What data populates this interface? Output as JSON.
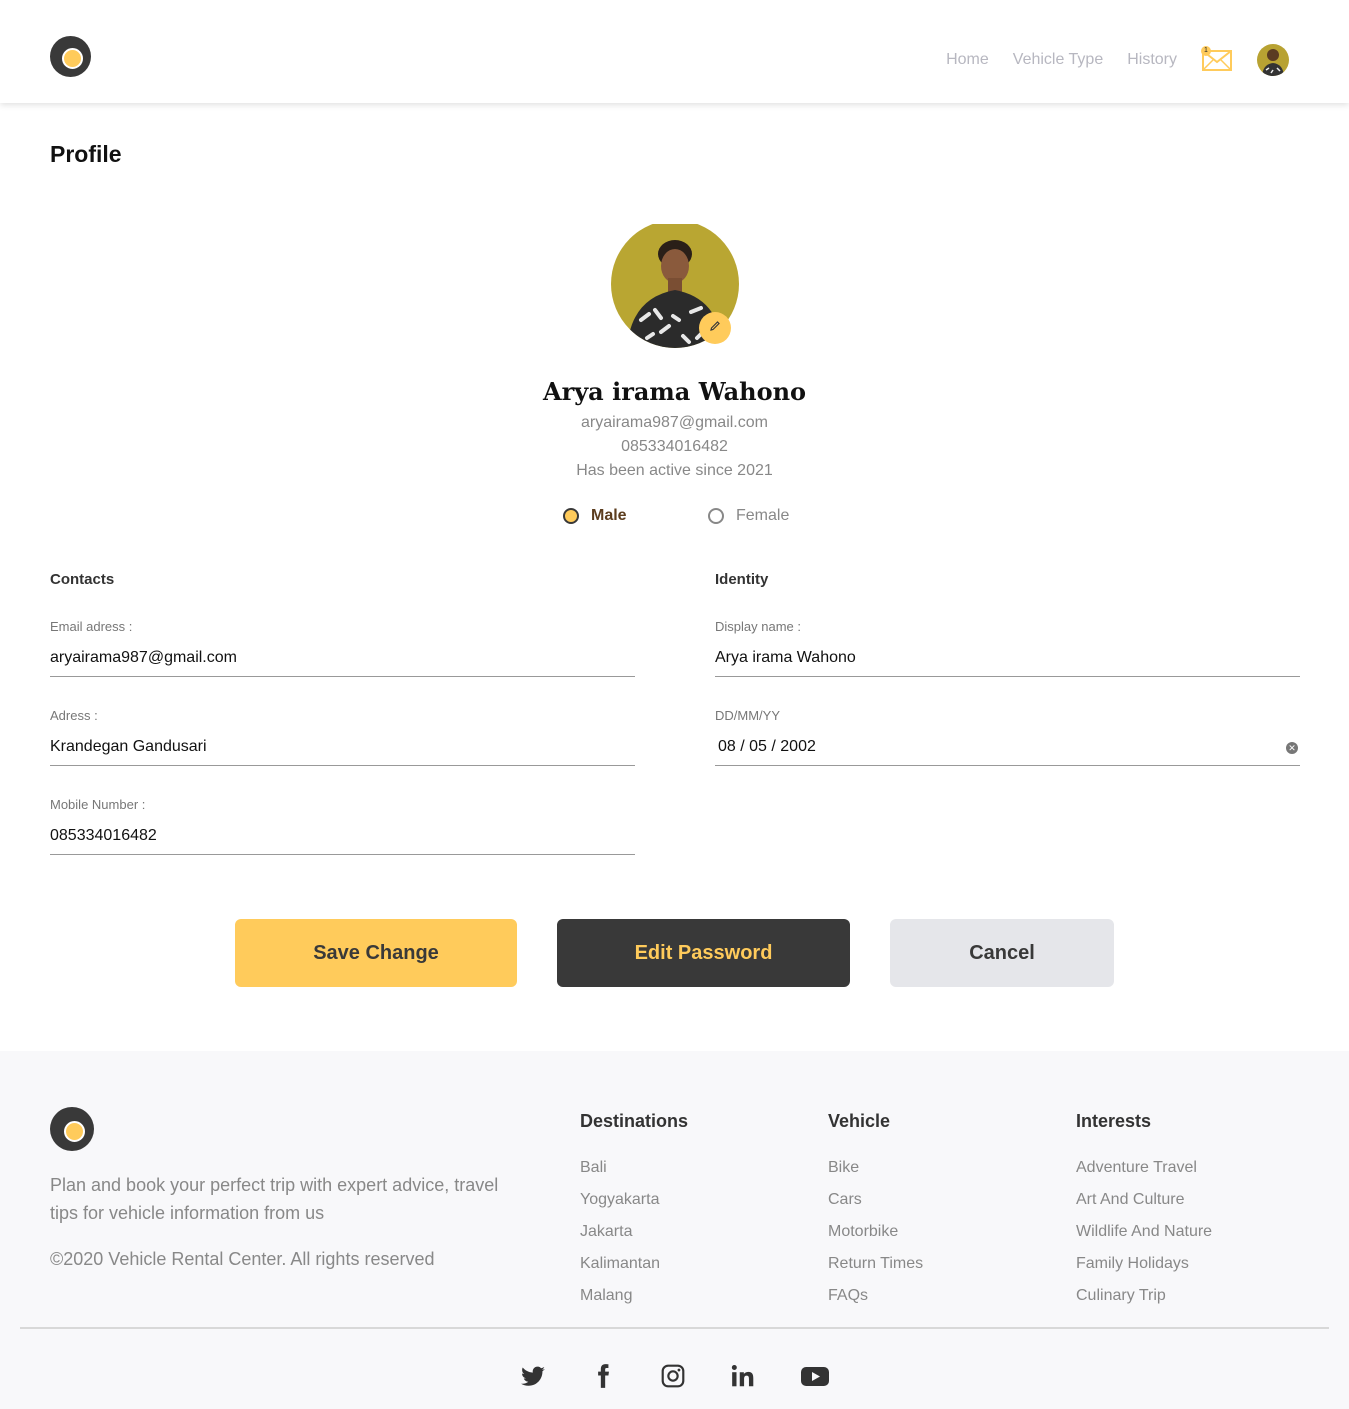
{
  "header": {
    "nav": [
      "Home",
      "Vehicle Type",
      "History"
    ],
    "mail_badge": "1"
  },
  "page_title": "Profile",
  "profile": {
    "name": "Arya irama Wahono",
    "email": "aryairama987@gmail.com",
    "phone": "085334016482",
    "active_since": "Has been active since 2021",
    "gender": {
      "male": "Male",
      "female": "Female",
      "selected": "Male"
    }
  },
  "contacts": {
    "heading": "Contacts",
    "email_label": "Email adress :",
    "email_value": "aryairama987@gmail.com",
    "address_label": "Adress :",
    "address_value": "Krandegan Gandusari",
    "mobile_label": "Mobile Number :",
    "mobile_value": "085334016482"
  },
  "identity": {
    "heading": "Identity",
    "display_label": "Display name :",
    "display_value": "Arya irama Wahono",
    "dob_label": "DD/MM/YY",
    "dob_value": "08 / 05 / 2002"
  },
  "buttons": {
    "save": "Save Change",
    "password": "Edit Password",
    "cancel": "Cancel"
  },
  "footer": {
    "tagline": "Plan and book your perfect trip with expert advice, travel tips for vehicle information from us",
    "copyright": "©2020 Vehicle Rental Center. All rights reserved",
    "columns": [
      {
        "title": "Destinations",
        "items": [
          "Bali",
          "Yogyakarta",
          "Jakarta",
          "Kalimantan",
          "Malang"
        ]
      },
      {
        "title": "Vehicle",
        "items": [
          "Bike",
          "Cars",
          "Motorbike",
          "Return Times",
          "FAQs"
        ]
      },
      {
        "title": "Interests",
        "items": [
          "Adventure Travel",
          "Art And Culture",
          "Wildlife And Nature",
          "Family Holidays",
          "Culinary Trip"
        ]
      }
    ],
    "social": [
      "twitter-icon",
      "facebook-icon",
      "instagram-icon",
      "linkedin-icon",
      "youtube-icon"
    ]
  },
  "colors": {
    "accent": "#ffcb5b",
    "dark": "#393939",
    "muted": "#888888",
    "footer_bg": "#f8f8fa"
  }
}
